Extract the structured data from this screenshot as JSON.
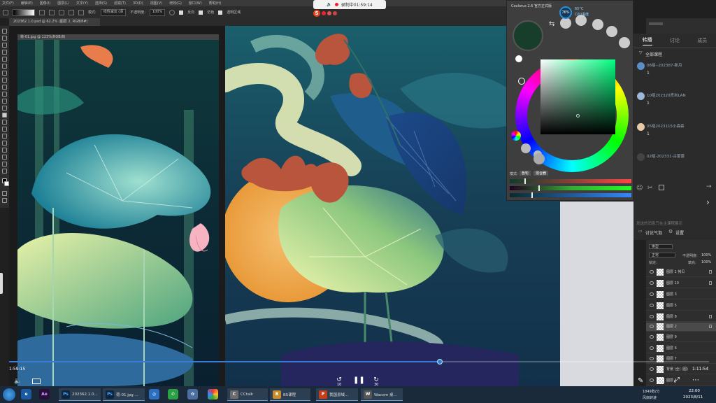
{
  "recorder": {
    "text": "录制中01:59:14"
  },
  "ps": {
    "menu": [
      "文件(F)",
      "编辑(E)",
      "图像(I)",
      "图层(L)",
      "文字(Y)",
      "选择(S)",
      "滤镜(T)",
      "3D(D)",
      "视图(V)",
      "增效(G)",
      "窗口(W)",
      "帮助(H)"
    ],
    "options": {
      "mode_label": "模式:",
      "mode_value": "线性减淡 (添",
      "opacity_label": "不透明度:",
      "opacity_value": "100%",
      "reverse": "反向",
      "dither": "仿色",
      "transparency": "透明区域"
    },
    "doc_tab": "202362.1.0.psd @ 62.2% (图层 2, RGB/8#)",
    "left_doc_title": "荷-01.jpg @ 123%(RGB/8)"
  },
  "coolorus": {
    "title": "Coolorus 2.6 官方正式版",
    "mode_label": "模式:",
    "btn1": "色轮",
    "btn2": "混合器",
    "wheel_colors": [
      "#ff0000",
      "#ffff00",
      "#00ff00",
      "#00ffff",
      "#0000ff",
      "#ff00ff"
    ],
    "current_color": "#173d2b"
  },
  "perf": {
    "cpu_percent": "76%",
    "temp": "65°C",
    "cpu_label": "CPU温度"
  },
  "chat": {
    "tabs": [
      "转播",
      "讨论",
      "成员"
    ],
    "category": "全部课程",
    "items": [
      {
        "name": "06组--202387-新月",
        "count": "1",
        "avatar_color": "#5a8ec8"
      },
      {
        "name": "10组202320青岚LAN",
        "count": "1",
        "avatar_color": "#9cb8d8"
      },
      {
        "name": "05组2023115小森森",
        "count": "1",
        "avatar_color": "#e8c9a8"
      },
      {
        "name": "02组-202331-古蕾蕾",
        "count": "1",
        "avatar_color": "#444444"
      }
    ],
    "input_placeholder": "发送的消息只在主课程展示",
    "discussion_label": "讨论气泡",
    "settings_label": "设置"
  },
  "layers": {
    "kind_label": "类型",
    "blend": "正常",
    "opacity_label": "不透明度:",
    "opacity": "100%",
    "lock_label": "锁定:",
    "fill_label": "填充:",
    "fill": "100%",
    "items": [
      "图层 1 拷贝",
      "图层 10",
      "图层 3",
      "图层 5",
      "图层 8",
      "图层 2",
      "图层 9",
      "图层 6",
      "图层 7",
      "背景 (全) (图)",
      "图层 4"
    ]
  },
  "video": {
    "time_left": "1:59:15",
    "time_right": "1:11:54",
    "skip_back": "10",
    "skip_fwd": "30",
    "progress": 0.615
  },
  "taskbar": {
    "items": [
      {
        "label": "202362.1.0...",
        "icon": "Ps",
        "color": "#0b2540"
      },
      {
        "label": "荷-01.jpg ...",
        "icon": "Ps",
        "color": "#0b2540"
      },
      {
        "label": "CCtalk",
        "icon": "C",
        "color": "#6a6a6a"
      },
      {
        "label": "BS课程",
        "icon": "B",
        "color": "#c98c2a"
      },
      {
        "label": "我国县域...",
        "icon": "P",
        "color": "#c43e1c"
      },
      {
        "label": "Wacom 桌...",
        "icon": "W",
        "color": "#555555"
      }
    ],
    "tray1": "1849数/分",
    "tray2": "风扇转速",
    "time": "22:00",
    "date": "2023/8/11"
  }
}
